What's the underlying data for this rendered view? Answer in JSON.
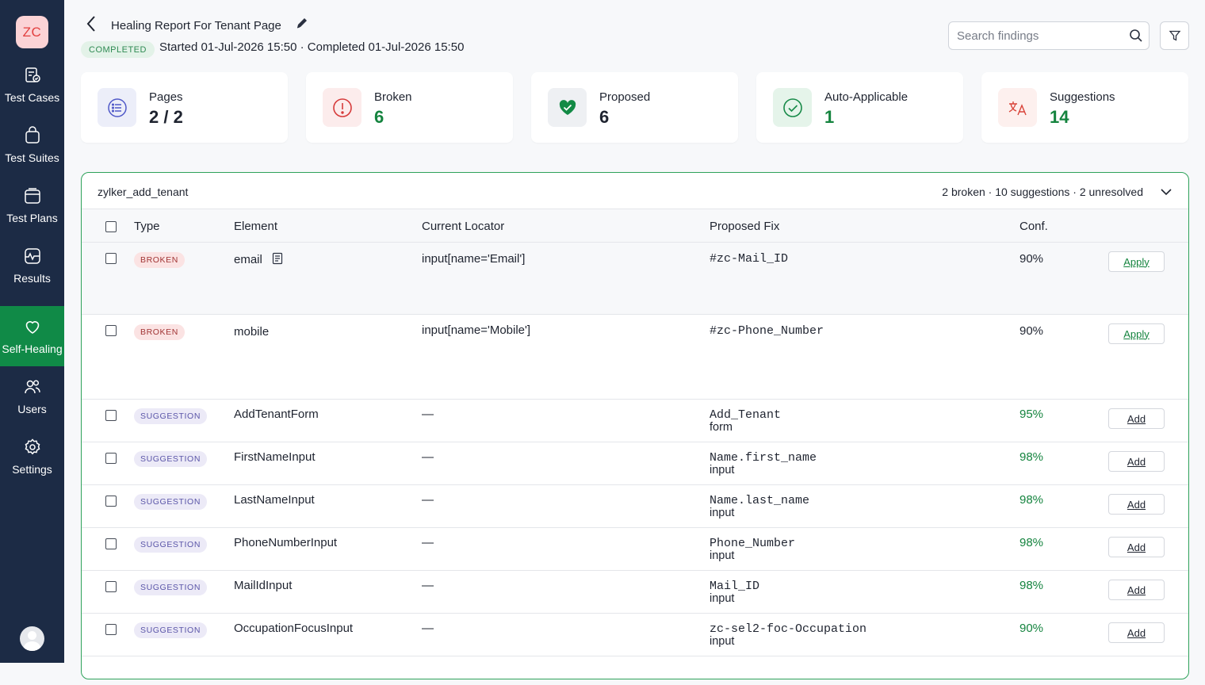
{
  "sidebar": {
    "logo": "ZC",
    "items": [
      {
        "label": "Test Cases",
        "icon": "test-cases-icon"
      },
      {
        "label": "Test Suites",
        "icon": "test-suites-icon"
      },
      {
        "label": "Test Plans",
        "icon": "test-plans-icon"
      },
      {
        "label": "Results",
        "icon": "results-icon"
      },
      {
        "label": "Self-Healing",
        "icon": "heart-icon",
        "active": true
      },
      {
        "label": "Users",
        "icon": "users-icon"
      },
      {
        "label": "Settings",
        "icon": "gear-icon"
      }
    ]
  },
  "header": {
    "title": "Healing Report For Tenant Page",
    "status": "COMPLETED",
    "timestamps": "Started 01-Jul-2026 15:50 · Completed 01-Jul-2026 15:50",
    "search_placeholder": "Search findings"
  },
  "stats": [
    {
      "label": "Pages",
      "value": "2 / 2",
      "icon": "list-icon",
      "value_color": "#1f2430"
    },
    {
      "label": "Broken",
      "value": "6",
      "icon": "alert-icon",
      "value_color": "#15843f"
    },
    {
      "label": "Proposed",
      "value": "6",
      "icon": "heart-check-icon",
      "value_color": "#1f2430"
    },
    {
      "label": "Auto-Applicable",
      "value": "1",
      "icon": "check-circle-icon",
      "value_color": "#15843f"
    },
    {
      "label": "Suggestions",
      "value": "14",
      "icon": "translate-icon",
      "value_color": "#15843f"
    }
  ],
  "panel": {
    "name": "zylker_add_tenant",
    "summary": "2 broken · 10 suggestions · 2 unresolved",
    "columns": {
      "type": "Type",
      "element": "Element",
      "current_locator": "Current Locator",
      "proposed_fix": "Proposed Fix",
      "conf": "Conf."
    },
    "rows": [
      {
        "type": "BROKEN",
        "element": "email",
        "locator": "input[name='Email']",
        "fix": "#zc-Mail_ID",
        "fix_type": "",
        "conf": "90%",
        "action": "Apply"
      },
      {
        "type": "BROKEN",
        "element": "mobile",
        "locator": "input[name='Mobile']",
        "fix": "#zc-Phone_Number",
        "fix_type": "",
        "conf": "90%",
        "action": "Apply"
      },
      {
        "type": "SUGGESTION",
        "element": "AddTenantForm",
        "locator": "—",
        "fix": "Add_Tenant",
        "fix_type": "form",
        "conf": "95%",
        "action": "Add"
      },
      {
        "type": "SUGGESTION",
        "element": "FirstNameInput",
        "locator": "—",
        "fix": "Name.first_name",
        "fix_type": "input",
        "conf": "98%",
        "action": "Add"
      },
      {
        "type": "SUGGESTION",
        "element": "LastNameInput",
        "locator": "—",
        "fix": "Name.last_name",
        "fix_type": "input",
        "conf": "98%",
        "action": "Add"
      },
      {
        "type": "SUGGESTION",
        "element": "PhoneNumberInput",
        "locator": "—",
        "fix": "Phone_Number",
        "fix_type": "input",
        "conf": "98%",
        "action": "Add"
      },
      {
        "type": "SUGGESTION",
        "element": "MailIdInput",
        "locator": "—",
        "fix": "Mail_ID",
        "fix_type": "input",
        "conf": "98%",
        "action": "Add"
      },
      {
        "type": "SUGGESTION",
        "element": "OccupationFocusInput",
        "locator": "—",
        "fix": "zc-sel2-foc-Occupation",
        "fix_type": "input",
        "conf": "90%",
        "action": "Add"
      }
    ]
  },
  "colors": {
    "sidebar_bg": "#1c2b45",
    "active_green": "#108a47",
    "accent_green": "#15843f",
    "panel_border": "#2ea25a"
  }
}
